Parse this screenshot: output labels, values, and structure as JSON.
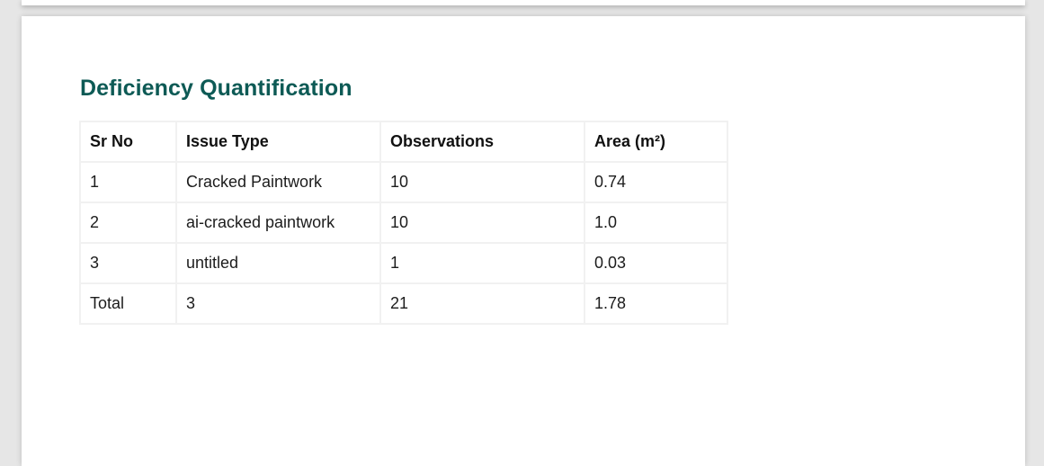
{
  "report": {
    "section_title": "Deficiency Quantification"
  },
  "table": {
    "headers": [
      "Sr No",
      "Issue Type",
      "Observations",
      "Area (m²)"
    ],
    "rows": [
      [
        "1",
        "Cracked Paintwork",
        "10",
        "0.74"
      ],
      [
        "2",
        "ai-cracked paintwork",
        "10",
        "1.0"
      ],
      [
        "3",
        "untitled",
        "1",
        "0.03"
      ]
    ],
    "total": [
      "Total",
      "3",
      "21",
      "1.78"
    ]
  }
}
